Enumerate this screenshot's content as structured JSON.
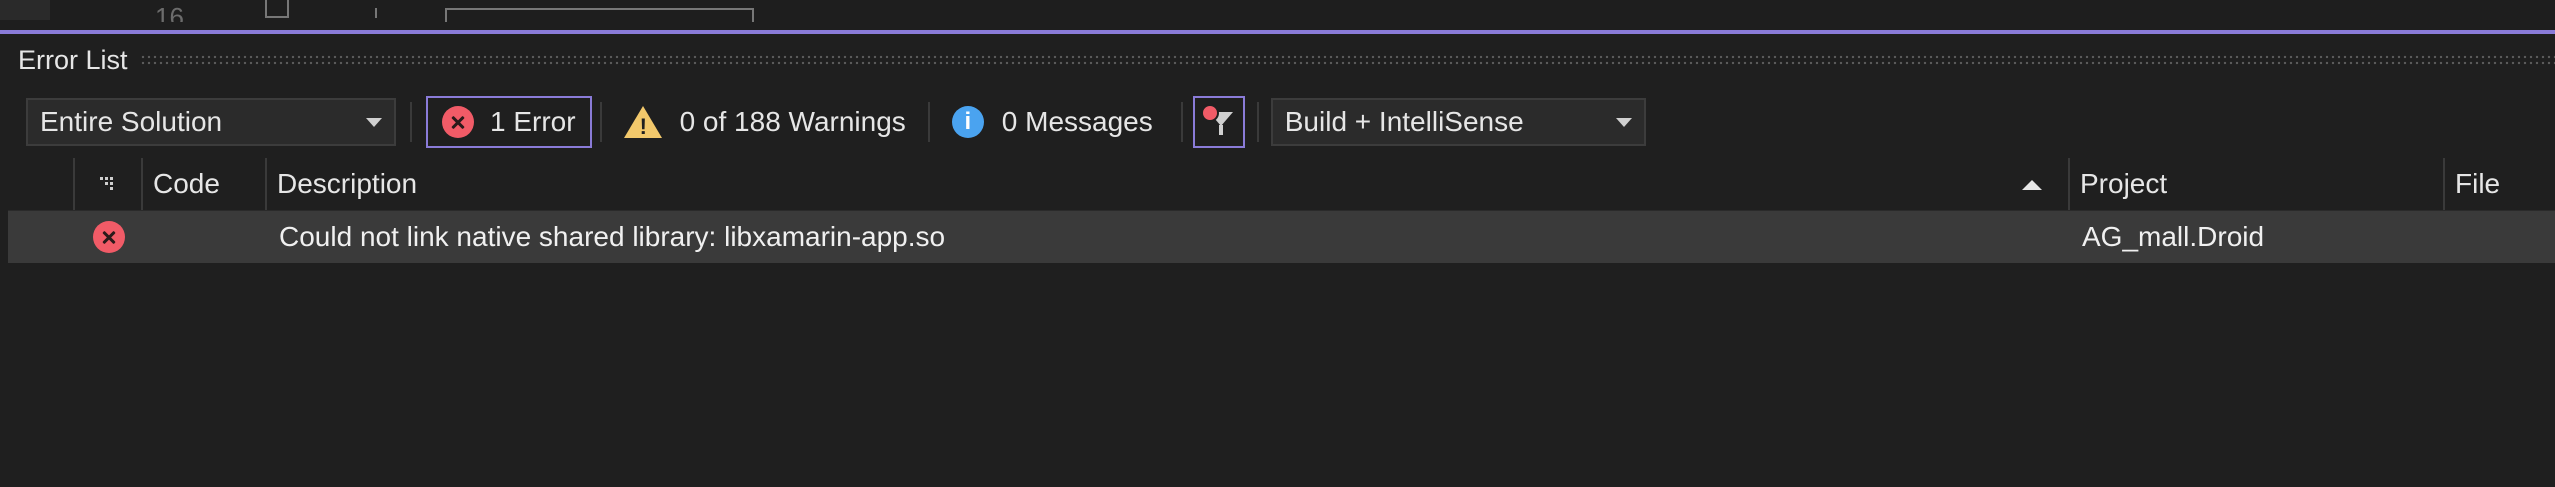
{
  "editor": {
    "line_number": "16"
  },
  "panel": {
    "title": "Error List"
  },
  "toolbar": {
    "scope_select": "Entire Solution",
    "errors_label": "1 Error",
    "warnings_label": "0 of 188 Warnings",
    "messages_label": "0 Messages",
    "source_select": "Build + IntelliSense"
  },
  "columns": {
    "code": "Code",
    "description": "Description",
    "project": "Project",
    "file": "File"
  },
  "rows": [
    {
      "severity_icon": "error-icon",
      "code": "",
      "description": "Could not link native shared library: libxamarin-app.so",
      "project": "AG_mall.Droid",
      "file": ""
    }
  ],
  "colors": {
    "accent": "#8a7bd8",
    "error": "#f15b67",
    "warning": "#f2c86b",
    "info": "#4aa3f0"
  }
}
